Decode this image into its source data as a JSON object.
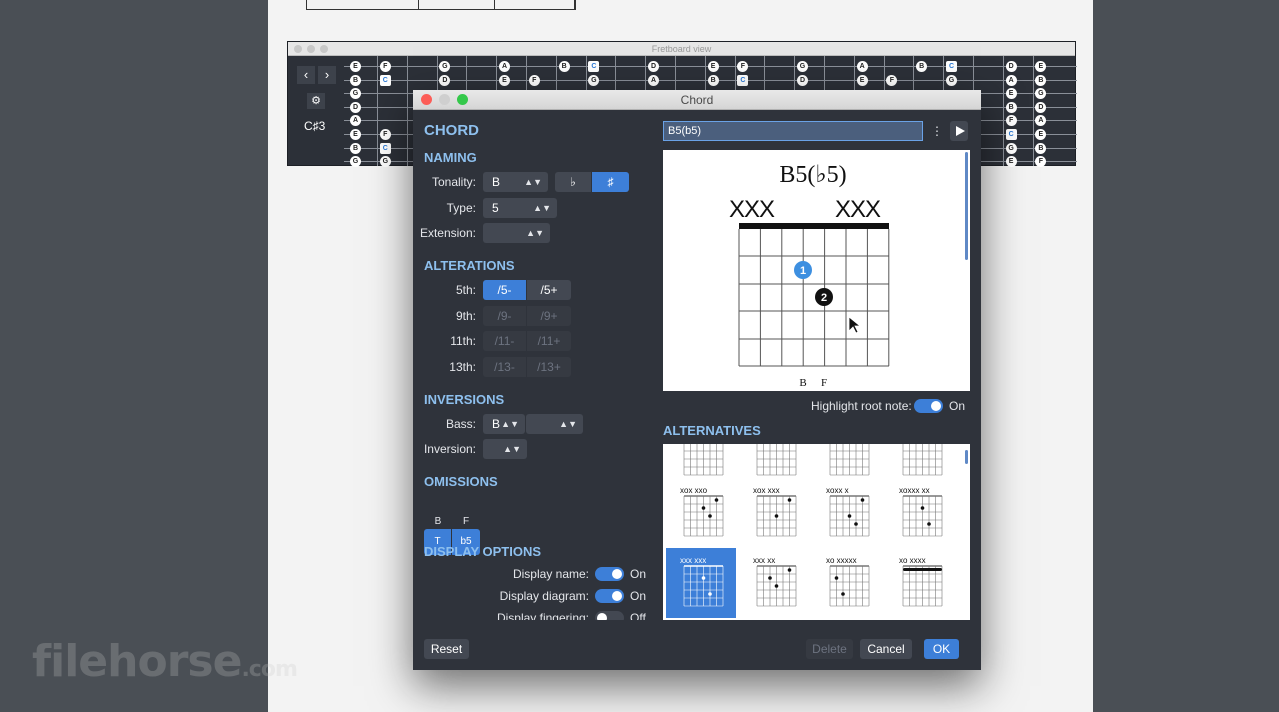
{
  "fretboard": {
    "title": "Fretboard view",
    "key_label": "C♯3",
    "prev_label": "‹",
    "next_label": "›",
    "notes": [
      {
        "s": 0,
        "f": 0,
        "t": "E"
      },
      {
        "s": 1,
        "f": 0,
        "t": "B"
      },
      {
        "s": 2,
        "f": 0,
        "t": "G"
      },
      {
        "s": 3,
        "f": 0,
        "t": "D"
      },
      {
        "s": 4,
        "f": 0,
        "t": "A"
      },
      {
        "s": 5,
        "f": 0,
        "t": "E"
      },
      {
        "s": 6,
        "f": 0,
        "t": "B"
      },
      {
        "s": 7,
        "f": 0,
        "t": "G"
      },
      {
        "s": 0,
        "f": 1,
        "t": "F"
      },
      {
        "s": 1,
        "f": 1,
        "t": "C",
        "b": 1
      },
      {
        "s": 5,
        "f": 1,
        "t": "F"
      },
      {
        "s": 6,
        "f": 1,
        "t": "C",
        "b": 1
      },
      {
        "s": 7,
        "f": 1,
        "t": "G"
      },
      {
        "s": 0,
        "f": 3,
        "t": "G"
      },
      {
        "s": 1,
        "f": 3,
        "t": "D"
      },
      {
        "s": 0,
        "f": 5,
        "t": "A"
      },
      {
        "s": 1,
        "f": 5,
        "t": "E"
      },
      {
        "s": 1,
        "f": 6,
        "t": "F"
      },
      {
        "s": 0,
        "f": 7,
        "t": "B"
      },
      {
        "s": 0,
        "f": 8,
        "t": "C",
        "b": 1
      },
      {
        "s": 1,
        "f": 8,
        "t": "G"
      },
      {
        "s": 0,
        "f": 10,
        "t": "D"
      },
      {
        "s": 1,
        "f": 10,
        "t": "A"
      },
      {
        "s": 0,
        "f": 12,
        "t": "E"
      },
      {
        "s": 1,
        "f": 12,
        "t": "B"
      },
      {
        "s": 0,
        "f": 13,
        "t": "F"
      },
      {
        "s": 1,
        "f": 13,
        "t": "C",
        "b": 1
      },
      {
        "s": 0,
        "f": 15,
        "t": "G"
      },
      {
        "s": 1,
        "f": 15,
        "t": "D"
      },
      {
        "s": 0,
        "f": 17,
        "t": "A"
      },
      {
        "s": 1,
        "f": 17,
        "t": "E"
      },
      {
        "s": 1,
        "f": 18,
        "t": "F"
      },
      {
        "s": 0,
        "f": 19,
        "t": "B"
      },
      {
        "s": 0,
        "f": 20,
        "t": "C",
        "b": 1
      },
      {
        "s": 1,
        "f": 20,
        "t": "G"
      },
      {
        "s": 0,
        "f": 22,
        "t": "D"
      },
      {
        "s": 1,
        "f": 22,
        "t": "A"
      },
      {
        "s": 2,
        "f": 22,
        "t": "E"
      },
      {
        "s": 3,
        "f": 22,
        "t": "B"
      },
      {
        "s": 4,
        "f": 22,
        "t": "F"
      },
      {
        "s": 5,
        "f": 22,
        "t": "C",
        "b": 1
      },
      {
        "s": 6,
        "f": 22,
        "t": "G"
      },
      {
        "s": 7,
        "f": 22,
        "t": "E"
      },
      {
        "s": 0,
        "f": 23,
        "t": "E"
      },
      {
        "s": 1,
        "f": 23,
        "t": "B"
      },
      {
        "s": 2,
        "f": 23,
        "t": "G"
      },
      {
        "s": 3,
        "f": 23,
        "t": "D"
      },
      {
        "s": 4,
        "f": 23,
        "t": "A"
      },
      {
        "s": 5,
        "f": 23,
        "t": "E"
      },
      {
        "s": 6,
        "f": 23,
        "t": "B"
      },
      {
        "s": 7,
        "f": 23,
        "t": "F"
      }
    ]
  },
  "dialog": {
    "title": "Chord",
    "heading": "CHORD",
    "naming": {
      "title": "NAMING",
      "tonality_label": "Tonality:",
      "tonality_value": "B",
      "flat_label": "♭",
      "sharp_label": "♯",
      "type_label": "Type:",
      "type_value": "5",
      "extension_label": "Extension:",
      "extension_value": ""
    },
    "alterations": {
      "title": "ALTERATIONS",
      "rows": [
        {
          "label": "5th:",
          "minus": "/5-",
          "plus": "/5+"
        },
        {
          "label": "9th:",
          "minus": "/9-",
          "plus": "/9+"
        },
        {
          "label": "11th:",
          "minus": "/11-",
          "plus": "/11+"
        },
        {
          "label": "13th:",
          "minus": "/13-",
          "plus": "/13+"
        }
      ]
    },
    "inversions": {
      "title": "INVERSIONS",
      "bass_label": "Bass:",
      "bass_value": "B",
      "bass_extra": "",
      "inversion_label": "Inversion:",
      "inversion_value": ""
    },
    "omissions": {
      "title": "OMISSIONS",
      "note1": "B",
      "note2": "F",
      "btn1": "T",
      "btn2": "b5"
    },
    "display": {
      "title": "DISPLAY OPTIONS",
      "name_label": "Display name:",
      "name_state": "On",
      "diagram_label": "Display diagram:",
      "diagram_state": "On",
      "fingering_label": "Display fingering:",
      "fingering_state": "Off"
    },
    "chord_name_input": "B5(b5)",
    "more_icon": "⋮",
    "diagram": {
      "chord_name": "B5(♭5)",
      "muted_left": "XXX",
      "muted_right": "XXX",
      "finger1": "1",
      "finger2": "2",
      "note_b": "B",
      "note_f": "F"
    },
    "highlight_label": "Highlight root note:",
    "highlight_state": "On",
    "alternatives_title": "ALTERNATIVES",
    "alternatives": [
      {
        "top": "xox xxo",
        "dots": [
          [
            5,
            0
          ],
          [
            3,
            1
          ],
          [
            4,
            2
          ]
        ]
      },
      {
        "top": "xox xxx",
        "dots": [
          [
            5,
            0
          ],
          [
            3,
            2
          ]
        ]
      },
      {
        "top": "xoxx  x",
        "dots": [
          [
            5,
            0
          ],
          [
            3,
            2
          ],
          [
            4,
            3
          ]
        ]
      },
      {
        "top": "xoxxx  xx",
        "dots": [
          [
            3,
            1
          ],
          [
            4,
            3
          ]
        ]
      },
      {
        "top": "xxx   xxx",
        "dots": [
          [
            3,
            1
          ],
          [
            4,
            3
          ]
        ]
      },
      {
        "top": "xxx    xx",
        "dots": [
          [
            5,
            0
          ],
          [
            2,
            1
          ],
          [
            3,
            2
          ]
        ]
      },
      {
        "top": "xo  xxxxx",
        "dots": [
          [
            1,
            1
          ],
          [
            2,
            3
          ]
        ]
      },
      {
        "top": "xo  xxxx",
        "dots": []
      }
    ],
    "buttons": {
      "reset": "Reset",
      "delete": "Delete",
      "cancel": "Cancel",
      "ok": "OK"
    }
  },
  "watermark": {
    "brand": "filehorse",
    "tld": ".com"
  }
}
